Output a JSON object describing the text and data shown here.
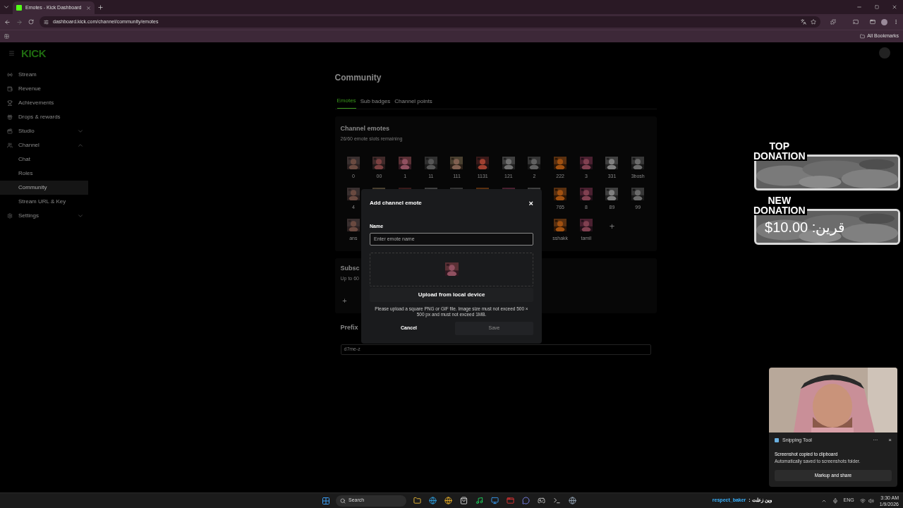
{
  "browser": {
    "tab_title": "Emotes - Kick Dashboard",
    "url": "dashboard.kick.com/channel/community/emotes",
    "bookmarks_label": "All Bookmarks"
  },
  "header": {
    "logo": "KICK"
  },
  "sidebar": {
    "items": [
      {
        "label": "Stream",
        "selected": false
      },
      {
        "label": "Revenue",
        "selected": false
      },
      {
        "label": "Achievements",
        "selected": false
      },
      {
        "label": "Drops & rewards",
        "selected": false
      },
      {
        "label": "Studio",
        "selected": false,
        "expanded": false
      },
      {
        "label": "Channel",
        "selected": false,
        "expanded": true,
        "children": [
          {
            "label": "Chat",
            "selected": false
          },
          {
            "label": "Roles",
            "selected": false
          },
          {
            "label": "Community",
            "selected": true
          },
          {
            "label": "Stream URL & Key",
            "selected": false
          }
        ]
      },
      {
        "label": "Settings",
        "selected": false,
        "expanded": false
      }
    ]
  },
  "page": {
    "title": "Community",
    "tabs": [
      {
        "label": "Emotes",
        "selected": true
      },
      {
        "label": "Sub badges",
        "selected": false
      },
      {
        "label": "Channel points",
        "selected": false
      }
    ],
    "channel_emotes": {
      "title": "Channel emotes",
      "subtitle": "26/60 emote slots remaining",
      "rows": [
        [
          {
            "label": "0"
          },
          {
            "label": "00"
          },
          {
            "label": "1"
          },
          {
            "label": "11"
          },
          {
            "label": "111"
          },
          {
            "label": "1131"
          },
          {
            "label": "121"
          },
          {
            "label": "2"
          },
          {
            "label": "222"
          },
          {
            "label": "3"
          },
          {
            "label": "331"
          },
          {
            "label": "3bosh"
          }
        ],
        [
          {
            "label": "4"
          },
          {},
          {},
          {},
          {},
          {},
          {},
          {},
          {
            "label": "765"
          },
          {
            "label": "8"
          },
          {
            "label": "89"
          },
          {
            "label": "99"
          }
        ],
        [
          {
            "label": "ans"
          },
          {},
          {},
          {},
          {},
          {},
          {},
          {},
          {
            "label": "sshakk"
          },
          {
            "label": "tamil"
          },
          {
            "kind": "add",
            "label": "+"
          }
        ]
      ]
    },
    "subscriber": {
      "title": "Subsc",
      "subtitle": "Up to 60",
      "add": "+"
    },
    "prefix": {
      "title": "Prefix",
      "value": "d7me-z"
    }
  },
  "dialog": {
    "title": "Add channel emote",
    "close": "×",
    "name_label": "Name",
    "name_placeholder": "Enter emote name",
    "upload_button": "Upload from local device",
    "help": "Please upload a square PNG or GIF file. Image size must not exceed 500 × 500 px and must not exceed 1MB.",
    "cancel": "Cancel",
    "save": {
      "label": "Save",
      "disabled": true
    }
  },
  "overlay": {
    "top_donation": {
      "line1": "TOP",
      "line2": "DONATION"
    },
    "new_donation": {
      "line1": "NEW",
      "line2": "DONATION",
      "value": "قرين: 10.00$"
    }
  },
  "toast": {
    "app": "Snipping Tool",
    "more": "···",
    "close": "×",
    "title": "Screenshot copied to clipboard",
    "body": "Automatically saved to screenshots folder.",
    "action": "Markup and share"
  },
  "taskbar": {
    "search": "Search",
    "notice_user": "respect_baker",
    "notice_text": "وين زعلت :",
    "language": "ENG",
    "time": "3:30 AM",
    "date": "1/9/2026"
  }
}
